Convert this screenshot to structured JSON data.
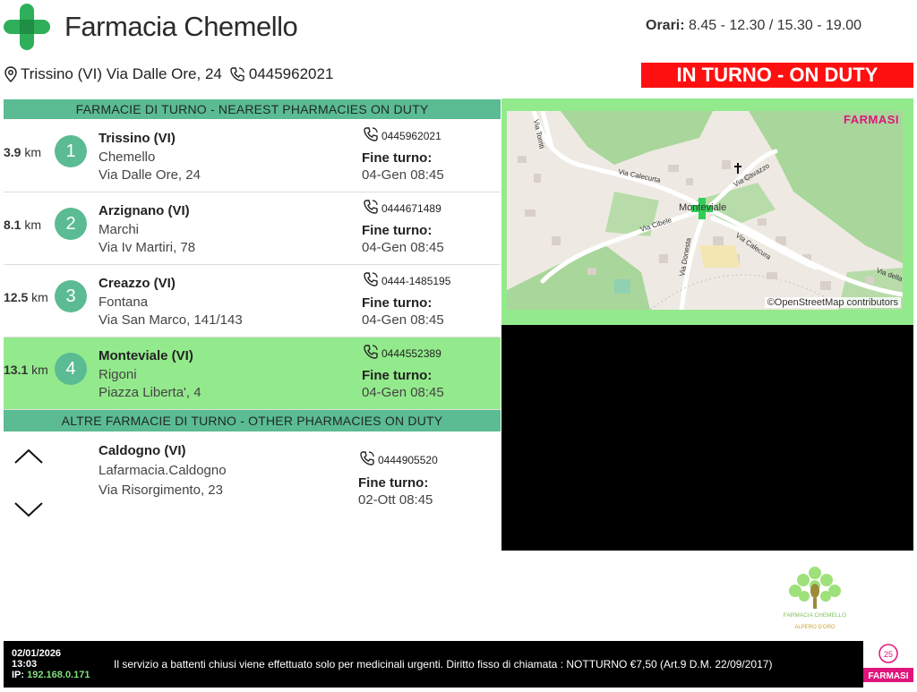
{
  "header": {
    "name": "Farmacia Chemello",
    "hours_label": "Orari:",
    "hours_value": "8.45 - 12.30 / 15.30 - 19.00",
    "address": "Trissino (VI) Via Dalle Ore, 24",
    "phone": "0445962021",
    "status": "IN TURNO - ON DUTY"
  },
  "nearest": {
    "title": "FARMACIE DI TURNO - NEAREST PHARMACIES ON DUTY",
    "km_unit": "km",
    "end_label": "Fine turno:",
    "items": [
      {
        "dist": "3.9",
        "num": "1",
        "city": "Trissino (VI)",
        "name": "Chemello",
        "street": "Via Dalle Ore, 24",
        "phone": "0445962021",
        "end": "04-Gen 08:45"
      },
      {
        "dist": "8.1",
        "num": "2",
        "city": "Arzignano (VI)",
        "name": "Marchi",
        "street": "Via Iv Martiri, 78",
        "phone": "0444671489",
        "end": "04-Gen 08:45"
      },
      {
        "dist": "12.5",
        "num": "3",
        "city": "Creazzo (VI)",
        "name": "Fontana",
        "street": "Via San Marco, 141/143",
        "phone": "0444-1485195",
        "end": "04-Gen 08:45"
      },
      {
        "dist": "13.1",
        "num": "4",
        "city": "Monteviale (VI)",
        "name": "Rigoni",
        "street": "Piazza Liberta', 4",
        "phone": "0444552389",
        "end": "04-Gen 08:45"
      }
    ]
  },
  "other": {
    "title": "ALTRE FARMACIE DI TURNO - OTHER PHARMACIES ON DUTY",
    "end_label": "Fine turno:",
    "item": {
      "city": "Caldogno (VI)",
      "name": "Lafarmacia.Caldogno",
      "street": "Via Risorgimento, 23",
      "phone": "0444905520",
      "end": "02-Ott 08:45"
    }
  },
  "map": {
    "brand": "FARMASI",
    "credit": "©OpenStreetMap contributors",
    "place": "Monteviale",
    "streets": [
      "Via Calecurta",
      "Via Cavazzo",
      "Via Cibele",
      "Via Calecura",
      "Via Donesta",
      "Via della Rore",
      "Via Torriti"
    ]
  },
  "logo": {
    "text": "FARMACIA CHEMELLO",
    "subtext": "ALPERO D'ORO"
  },
  "footer": {
    "date": "02/01/2026",
    "time": "13:03",
    "ip_label": "IP:",
    "ip": "192.168.0.171",
    "notice": "Il servizio a battenti chiusi viene effettuato solo per medicinali urgenti. Diritto fisso di chiamata : NOTTURNO €7,50 (Art.9 D.M. 22/09/2017)",
    "brand": "FARMASI"
  },
  "colors": {
    "green": "#5bbb92",
    "highlight": "#93ea8c",
    "red": "#ff1010",
    "brand": "#e0157c"
  }
}
